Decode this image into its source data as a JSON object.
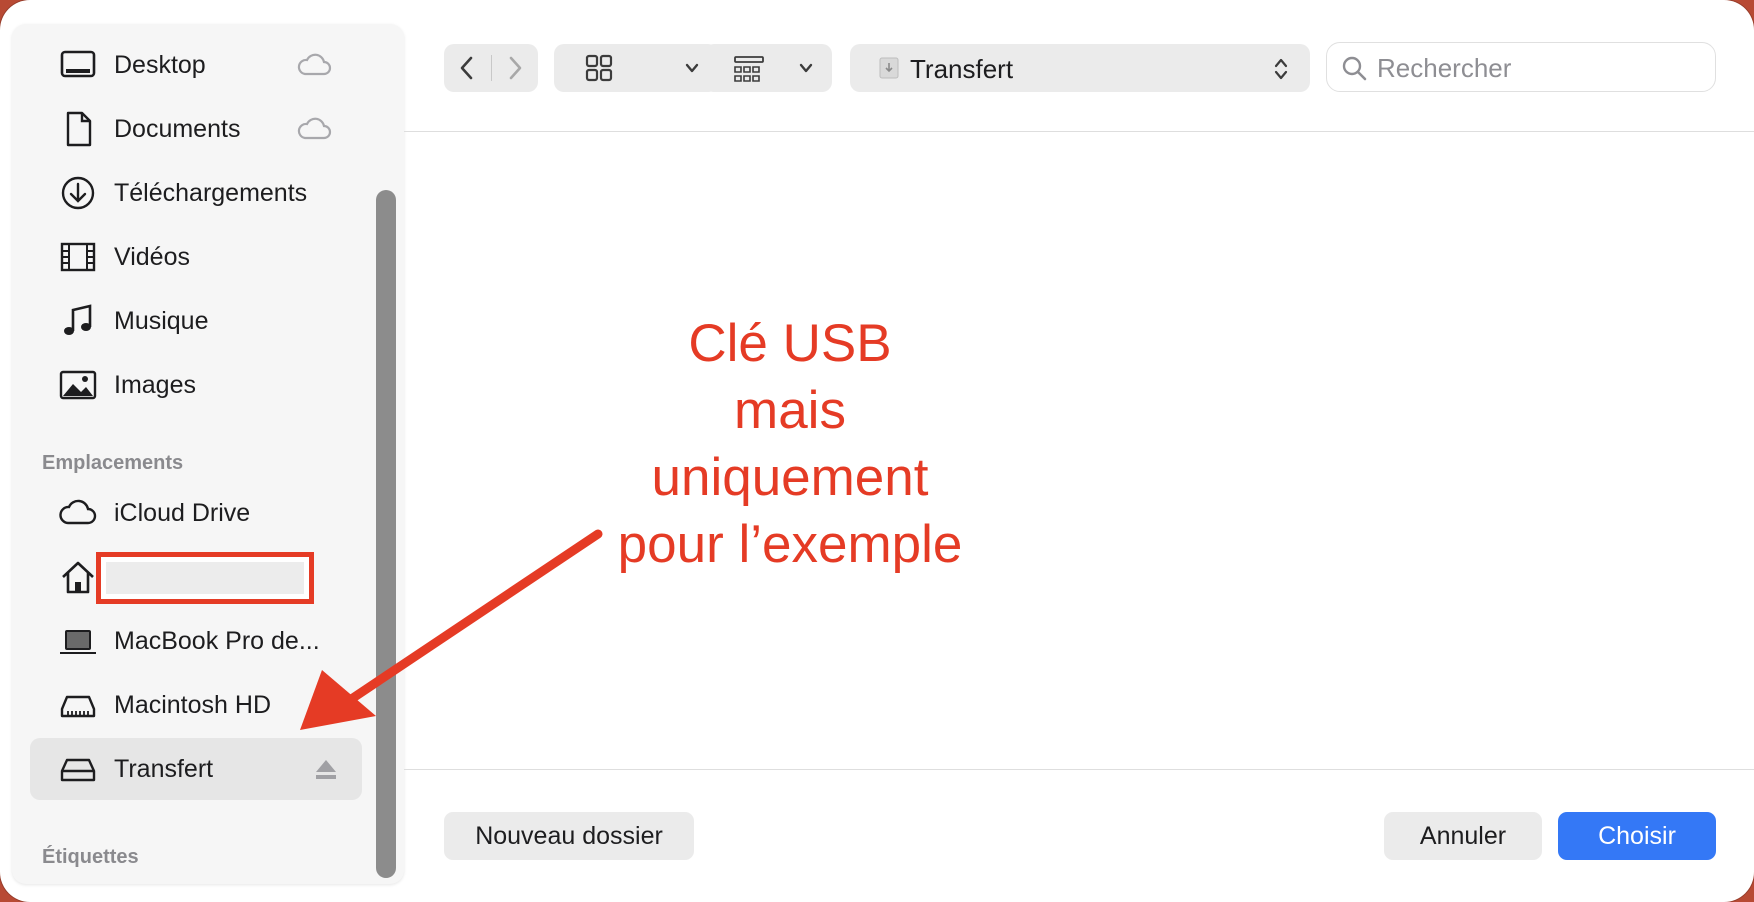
{
  "sidebar": {
    "favorites": [
      {
        "label": "Desktop",
        "icon": "desktop-icon",
        "cloud": true
      },
      {
        "label": "Documents",
        "icon": "document-icon",
        "cloud": true
      },
      {
        "label": "Téléchargements",
        "icon": "download-icon",
        "cloud": false
      },
      {
        "label": "Vidéos",
        "icon": "film-icon",
        "cloud": false
      },
      {
        "label": "Musique",
        "icon": "music-note-icon",
        "cloud": false
      },
      {
        "label": "Images",
        "icon": "photo-icon",
        "cloud": false
      }
    ],
    "locations_heading": "Emplacements",
    "locations": [
      {
        "label": "iCloud Drive",
        "icon": "cloud-icon"
      },
      {
        "label": "",
        "icon": "home-icon",
        "redacted": true
      },
      {
        "label": "MacBook Pro de...",
        "icon": "laptop-icon"
      },
      {
        "label": "Macintosh HD",
        "icon": "internal-disk-icon"
      },
      {
        "label": "Transfert",
        "icon": "external-disk-icon",
        "selected": true,
        "ejectable": true
      }
    ],
    "tags_heading": "Étiquettes"
  },
  "toolbar": {
    "path_label": "Transfert",
    "search_placeholder": "Rechercher"
  },
  "annotation": {
    "lines": [
      "Clé USB",
      "mais",
      "uniquement",
      "pour l’exemple"
    ],
    "color": "#e53b25"
  },
  "footer": {
    "new_folder_label": "Nouveau dossier",
    "cancel_label": "Annuler",
    "choose_label": "Choisir",
    "accent_color": "#3478f6"
  }
}
